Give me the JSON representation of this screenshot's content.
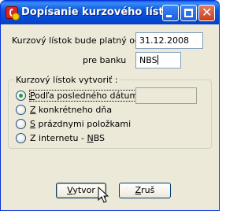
{
  "window": {
    "title": "Dopísanie kurzového lístka",
    "controls": [
      "minimize-icon",
      "maximize-icon",
      "close-icon"
    ]
  },
  "form": {
    "valid_from_label": "Kurzový lístok bude platný od:",
    "valid_from_value": "31.12.2008",
    "bank_label": "pre banku",
    "bank_value": "NBS"
  },
  "group": {
    "legend": "Kurzový lístok vytvoriť :",
    "options": [
      {
        "prefix": "",
        "mnemonic": "P",
        "rest": "odľa posledného dátumu",
        "checked": true
      },
      {
        "prefix": "",
        "mnemonic": "Z",
        "rest": " konkrétneho dňa",
        "checked": false
      },
      {
        "prefix": "",
        "mnemonic": "S",
        "rest": " prázdnymi položkami",
        "checked": false
      },
      {
        "prefix": "Z internetu - ",
        "mnemonic": "N",
        "rest": "BS",
        "checked": false
      }
    ],
    "date_value": ""
  },
  "buttons": {
    "create_mnemonic": "V",
    "create_rest": "ytvor",
    "cancel_mnemonic": "Z",
    "cancel_rest": "ruš"
  }
}
